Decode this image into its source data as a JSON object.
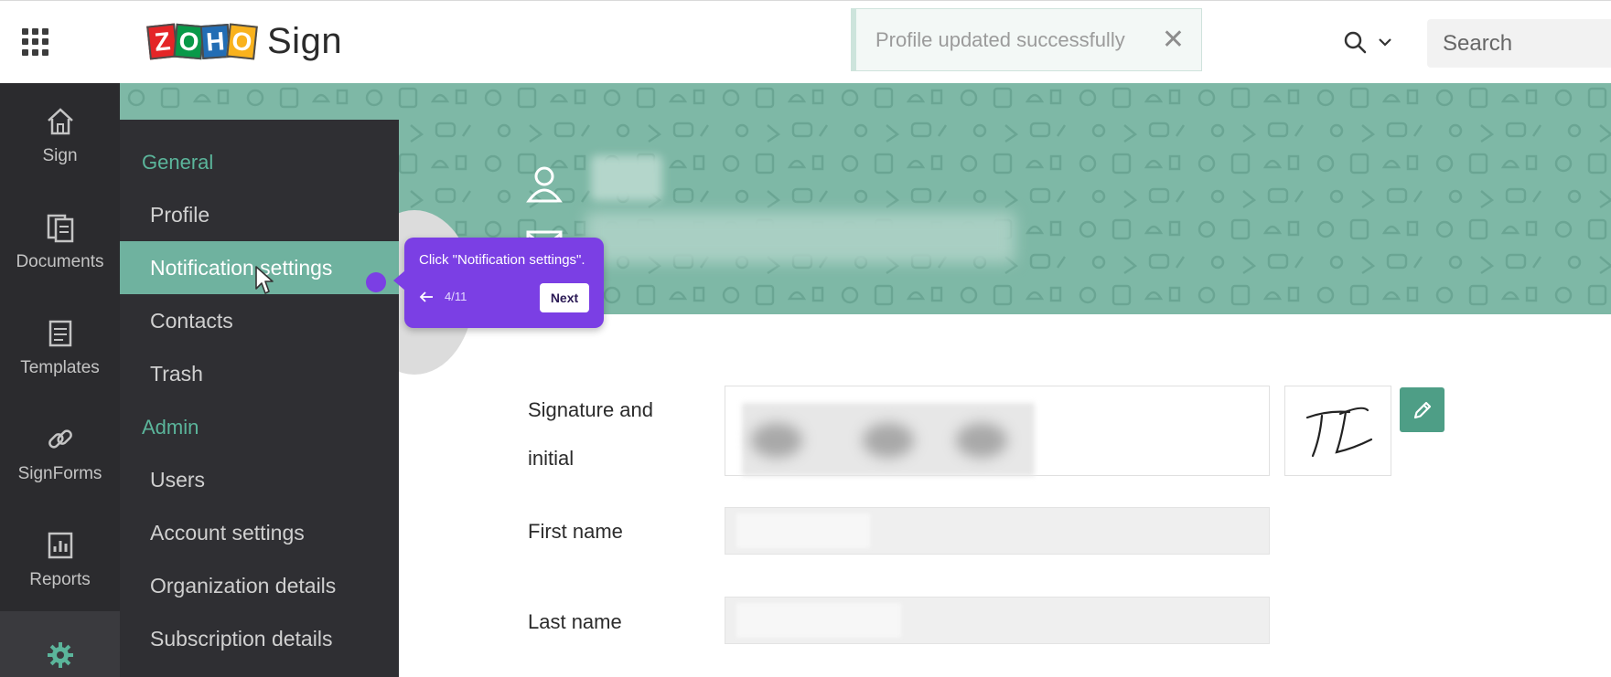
{
  "header": {
    "app_name": "Sign",
    "logo_letters": [
      "Z",
      "O",
      "H",
      "O"
    ],
    "search_placeholder": "Search"
  },
  "toast": {
    "message": "Profile updated successfully",
    "close_glyph": "✕"
  },
  "rail": {
    "items": [
      {
        "label": "Sign",
        "icon": "home-icon"
      },
      {
        "label": "Documents",
        "icon": "documents-icon"
      },
      {
        "label": "Templates",
        "icon": "templates-icon"
      },
      {
        "label": "SignForms",
        "icon": "link-icon"
      },
      {
        "label": "Reports",
        "icon": "reports-icon"
      },
      {
        "label": "",
        "icon": "gear-icon"
      }
    ]
  },
  "submenu": {
    "general_heading": "General",
    "general_items": [
      "Profile",
      "Notification settings",
      "Contacts",
      "Trash"
    ],
    "admin_heading": "Admin",
    "admin_items": [
      "Users",
      "Account settings",
      "Organization details",
      "Subscription details"
    ],
    "active_item": "Notification settings"
  },
  "tooltip": {
    "text": "Click \"Notification settings\".",
    "step": "4/11",
    "next_label": "Next"
  },
  "form": {
    "signature_label_line1": "Signature and",
    "signature_label_line2": "initial",
    "initial_text": "TJ",
    "first_name_label": "First name",
    "last_name_label": "Last name"
  },
  "colors": {
    "accent_green": "#6fb29f",
    "banner": "#7eb8a6",
    "tooltip_purple": "#7b3fe4",
    "rail_bg": "#2b2b2e"
  }
}
